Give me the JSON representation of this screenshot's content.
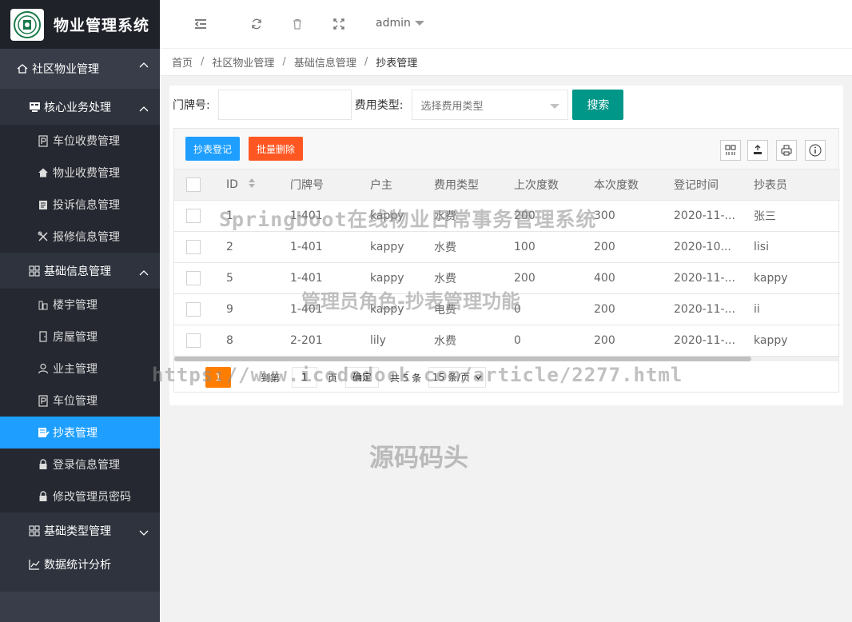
{
  "app": {
    "title": "物业管理系统"
  },
  "topbar": {
    "user": "admin"
  },
  "sidebar": {
    "groups": [
      {
        "label": "社区物业管理"
      },
      {
        "label": "核心业务处理"
      },
      {
        "label": "基础信息管理"
      },
      {
        "label": "基础类型管理"
      }
    ],
    "items": [
      {
        "label": "车位收费管理"
      },
      {
        "label": "物业收费管理"
      },
      {
        "label": "投诉信息管理"
      },
      {
        "label": "报修信息管理"
      },
      {
        "label": "楼宇管理"
      },
      {
        "label": "房屋管理"
      },
      {
        "label": "业主管理"
      },
      {
        "label": "车位管理"
      },
      {
        "label": "抄表管理"
      },
      {
        "label": "登录信息管理"
      },
      {
        "label": "修改管理员密码"
      },
      {
        "label": "数据统计分析"
      }
    ]
  },
  "breadcrumb": [
    "首页",
    "社区物业管理",
    "基础信息管理",
    "抄表管理"
  ],
  "search": {
    "door_label": "门牌号:",
    "door_value": "",
    "fee_label": "费用类型:",
    "fee_placeholder": "选择费用类型",
    "button": "搜索"
  },
  "toolbar": {
    "add": "抄表登记",
    "batch_delete": "批量删除"
  },
  "table": {
    "headers": [
      "ID",
      "门牌号",
      "户主",
      "费用类型",
      "上次度数",
      "本次度数",
      "登记时间",
      "抄表员"
    ],
    "rows": [
      [
        "1",
        "1-401",
        "kappy",
        "水费",
        "200",
        "300",
        "2020-11-...",
        "张三"
      ],
      [
        "2",
        "1-401",
        "kappy",
        "水费",
        "100",
        "200",
        "2020-10...",
        "lisi"
      ],
      [
        "5",
        "1-401",
        "kappy",
        "水费",
        "200",
        "400",
        "2020-11-...",
        "kappy"
      ],
      [
        "9",
        "1-401",
        "kappy",
        "电费",
        "0",
        "200",
        "2020-11-...",
        "ii"
      ],
      [
        "8",
        "2-201",
        "lily",
        "水费",
        "0",
        "200",
        "2020-11-...",
        "kappy"
      ]
    ]
  },
  "pager": {
    "current": "1",
    "goto_label": "到第",
    "page_value": "1",
    "page_unit": "页",
    "confirm": "确定",
    "total": "共 5 条",
    "per_page": "15 条/页"
  },
  "watermarks": {
    "w1": "Springboot在线物业日常事务管理系统",
    "w2": "管理员角色-抄表管理功能",
    "w3": "https://www.icodedock.com/article/2277.html",
    "w4": "源码码头"
  },
  "colors": {
    "sidebar": "#2e333d",
    "active": "#1e9fff",
    "search_btn": "#009688",
    "delete_btn": "#ff5722",
    "page_active": "#ff7e00"
  }
}
